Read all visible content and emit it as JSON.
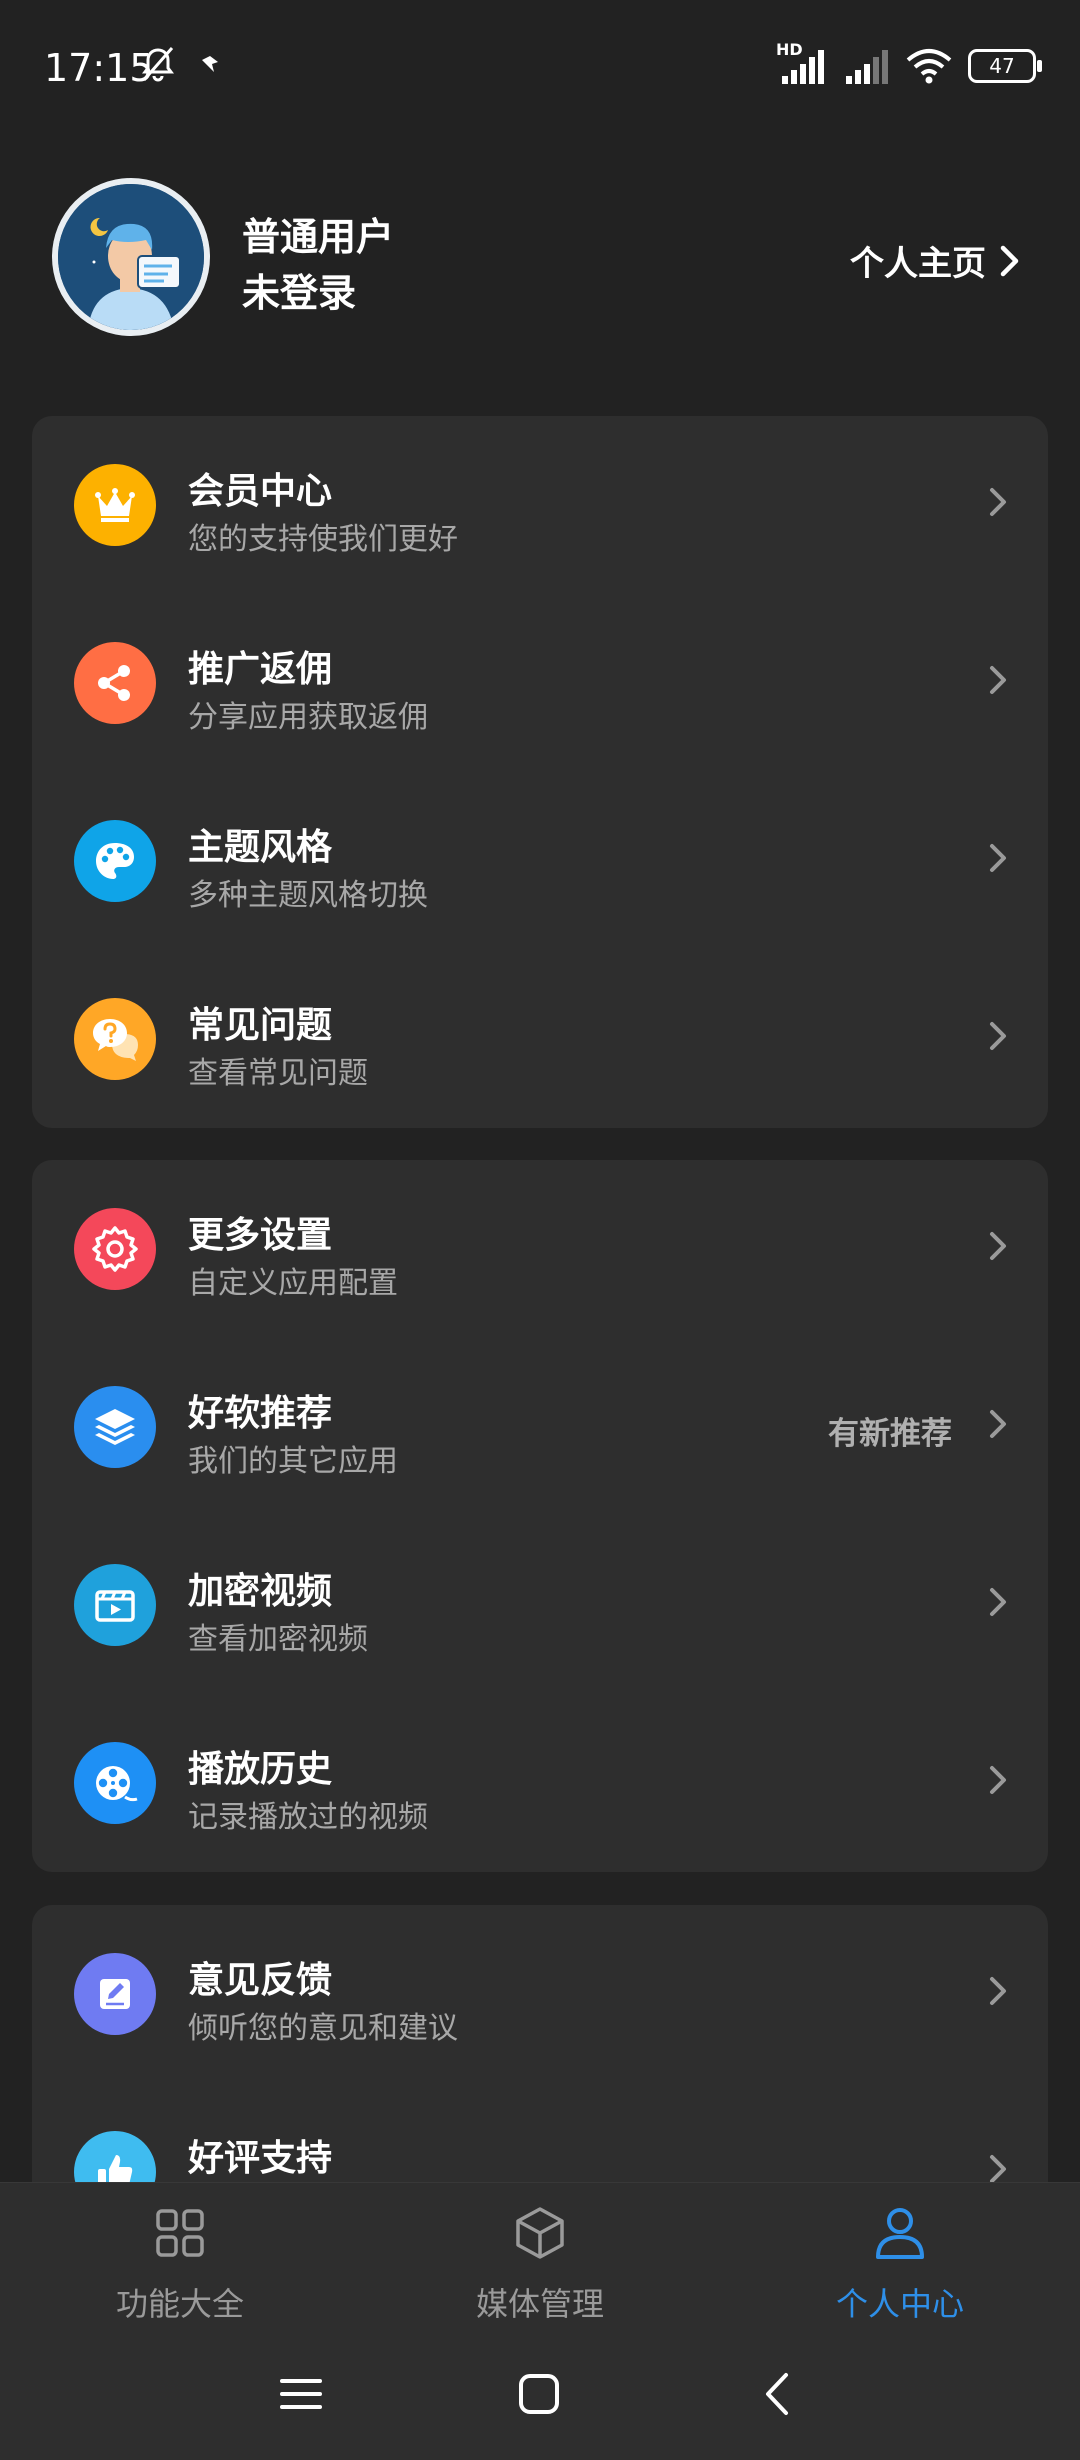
{
  "status_bar": {
    "time": "17:15",
    "network_label": "HD",
    "battery": "47"
  },
  "profile": {
    "user_name": "普通用户",
    "login_status": "未登录",
    "homepage_link": "个人主页"
  },
  "sections": [
    {
      "items": [
        {
          "title": "会员中心",
          "subtitle": "您的支持使我们更好",
          "icon": "crown-icon",
          "color": "#FDB100"
        },
        {
          "title": "推广返佣",
          "subtitle": "分享应用获取返佣",
          "icon": "share-icon",
          "color": "#FF6E44"
        },
        {
          "title": "主题风格",
          "subtitle": "多种主题风格切换",
          "icon": "palette-icon",
          "color": "#0FA4E8"
        },
        {
          "title": "常见问题",
          "subtitle": "查看常见问题",
          "icon": "question-bubble-icon",
          "color": "#FFA726"
        }
      ]
    },
    {
      "items": [
        {
          "title": "更多设置",
          "subtitle": "自定义应用配置",
          "icon": "gear-icon",
          "color": "#F4485A"
        },
        {
          "title": "好软推荐",
          "subtitle": "我们的其它应用",
          "icon": "layers-icon",
          "color": "#2A8EEF",
          "badge": "有新推荐"
        },
        {
          "title": "加密视频",
          "subtitle": "查看加密视频",
          "icon": "video-clapper-icon",
          "color": "#1FA1DC"
        },
        {
          "title": "播放历史",
          "subtitle": "记录播放过的视频",
          "icon": "film-reel-icon",
          "color": "#1E90F5"
        }
      ]
    },
    {
      "items": [
        {
          "title": "意见反馈",
          "subtitle": "倾听您的意见和建议",
          "icon": "edit-note-icon",
          "color": "#6F7BF2"
        },
        {
          "title": "好评支持",
          "subtitle": "",
          "icon": "thumbs-up-icon",
          "color": "#3FBCF0"
        }
      ]
    }
  ],
  "bottom_nav": {
    "tabs": [
      {
        "label": "功能大全",
        "icon": "grid-icon",
        "active": false
      },
      {
        "label": "媒体管理",
        "icon": "cube-icon",
        "active": false
      },
      {
        "label": "个人中心",
        "icon": "person-icon",
        "active": true
      }
    ],
    "active_color": "#2E8FE8",
    "inactive_color": "#9A9A9A"
  }
}
